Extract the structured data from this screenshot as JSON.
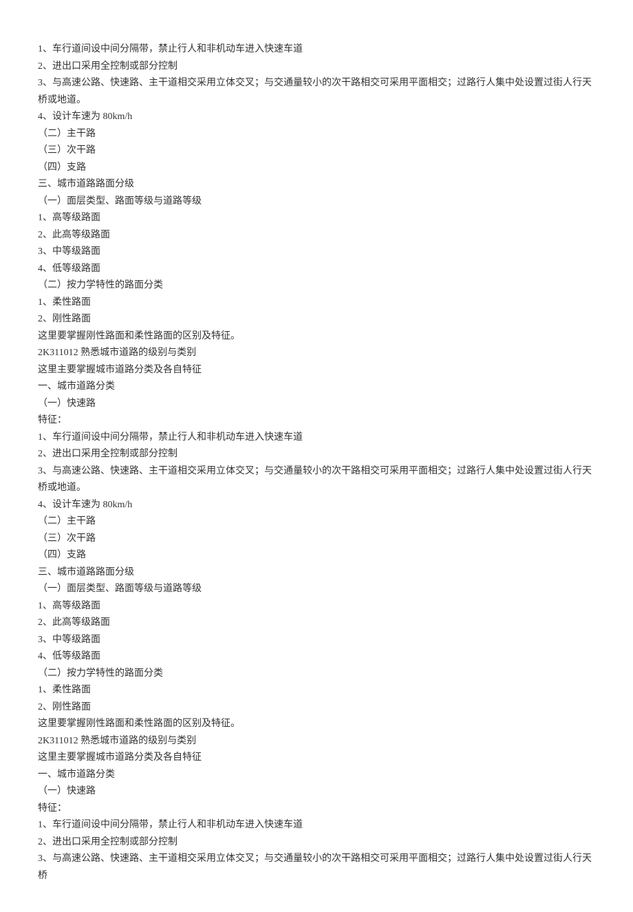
{
  "lines": [
    "1、车行道间设中间分隔带，禁止行人和非机动车进入快速车道",
    "2、进出口采用全控制或部分控制",
    "3、与高速公路、快速路、主干道相交采用立体交叉；与交通量较小的次干路相交可采用平面相交；过路行人集中处设置过街人行天桥或地道。",
    "4、设计车速为 80km/h",
    "（二）主干路",
    "（三）次干路",
    "（四）支路",
    "三、城市道路路面分级",
    "（一）面层类型、路面等级与道路等级",
    "1、高等级路面",
    "2、此高等级路面",
    "3、中等级路面",
    "4、低等级路面",
    "（二）按力学特性的路面分类",
    "1、柔性路面",
    "2、刚性路面",
    "这里要掌握刚性路面和柔性路面的区别及特征。",
    "2K311012 熟悉城市道路的级别与类别",
    "这里主要掌握城市道路分类及各自特征",
    "一、城市道路分类",
    "（一）快速路",
    "特征：",
    "1、车行道间设中间分隔带，禁止行人和非机动车进入快速车道",
    "2、进出口采用全控制或部分控制",
    "3、与高速公路、快速路、主干道相交采用立体交叉；与交通量较小的次干路相交可采用平面相交；过路行人集中处设置过街人行天桥或地道。",
    "4、设计车速为 80km/h",
    "（二）主干路",
    "（三）次干路",
    "（四）支路",
    "三、城市道路路面分级",
    "（一）面层类型、路面等级与道路等级",
    "1、高等级路面",
    "2、此高等级路面",
    "3、中等级路面",
    "4、低等级路面",
    "（二）按力学特性的路面分类",
    "1、柔性路面",
    "2、刚性路面",
    "这里要掌握刚性路面和柔性路面的区别及特征。",
    "2K311012 熟悉城市道路的级别与类别",
    "这里主要掌握城市道路分类及各自特征",
    "一、城市道路分类",
    "（一）快速路",
    "特征：",
    "1、车行道间设中间分隔带，禁止行人和非机动车进入快速车道",
    "2、进出口采用全控制或部分控制",
    "3、与高速公路、快速路、主干道相交采用立体交叉；与交通量较小的次干路相交可采用平面相交；过路行人集中处设置过街人行天桥"
  ]
}
